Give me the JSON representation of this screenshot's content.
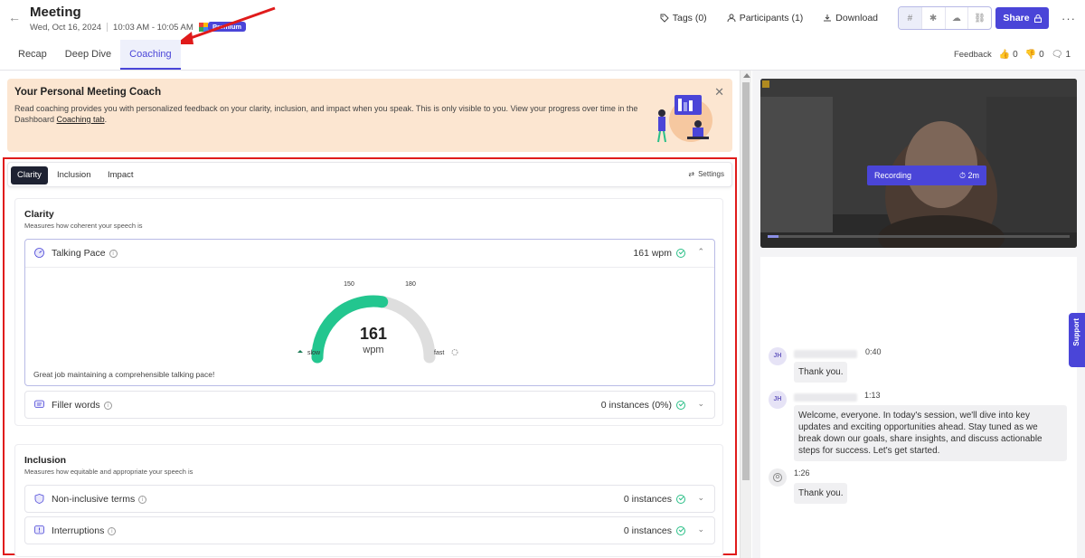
{
  "header": {
    "title": "Meeting",
    "date": "Wed, Oct 16, 2024",
    "time": "10:03 AM - 10:05 AM",
    "badge": "Premium",
    "actions": {
      "tags": "Tags (0)",
      "participants": "Participants (1)",
      "download": "Download",
      "share": "Share"
    },
    "tabs": [
      "Recap",
      "Deep Dive",
      "Coaching"
    ],
    "active_tab": "Coaching",
    "feedback": {
      "label": "Feedback",
      "thumbs_up": "0",
      "thumbs_down": "0",
      "comments": "1"
    }
  },
  "banner": {
    "title": "Your Personal Meeting Coach",
    "text": "Read coaching provides you with personalized feedback on your clarity, inclusion, and impact when you speak. This is only visible to you. View your progress over time in the Dashboard ",
    "link": "Coaching tab",
    "text_end": "."
  },
  "coaching": {
    "tabs": [
      "Clarity",
      "Inclusion",
      "Impact"
    ],
    "active_tab": "Clarity",
    "settings_label": "Settings",
    "clarity": {
      "title": "Clarity",
      "description": "Measures how coherent your speech is",
      "talking_pace": {
        "label": "Talking Pace",
        "value": "161 wpm",
        "gauge_value": "161",
        "gauge_unit": "wpm",
        "gauge_min_label": "150",
        "gauge_max_label": "180",
        "slow_label": "slow",
        "fast_label": "fast",
        "pace_level": 0.55,
        "message": "Great job maintaining a comprehensible talking pace!"
      },
      "filler_words": {
        "label": "Filler words",
        "value": "0 instances (0%)"
      }
    },
    "inclusion": {
      "title": "Inclusion",
      "description": "Measures how equitable and appropriate your speech is",
      "non_inclusive": {
        "label": "Non-inclusive terms",
        "value": "0 instances"
      },
      "interruptions": {
        "label": "Interruptions",
        "value": "0 instances"
      }
    }
  },
  "video": {
    "recording_label": "Recording",
    "recording_time": "2m"
  },
  "transcript": [
    {
      "initials": "JH",
      "time": "0:40",
      "text": "Thank you."
    },
    {
      "initials": "JH",
      "time": "1:13",
      "text": "Welcome, everyone. In today's session, we'll dive into key updates and exciting opportunities ahead. Stay tuned as we break down our goals, share insights, and discuss actionable steps for success. Let's get started."
    },
    {
      "initials": "",
      "time": "1:26",
      "text": "Thank you."
    }
  ],
  "support_label": "Support",
  "colors": {
    "accent": "#4a45d8",
    "success": "#2abf87",
    "banner_bg": "#fce6d1",
    "annotation_red": "#e01b1b"
  }
}
